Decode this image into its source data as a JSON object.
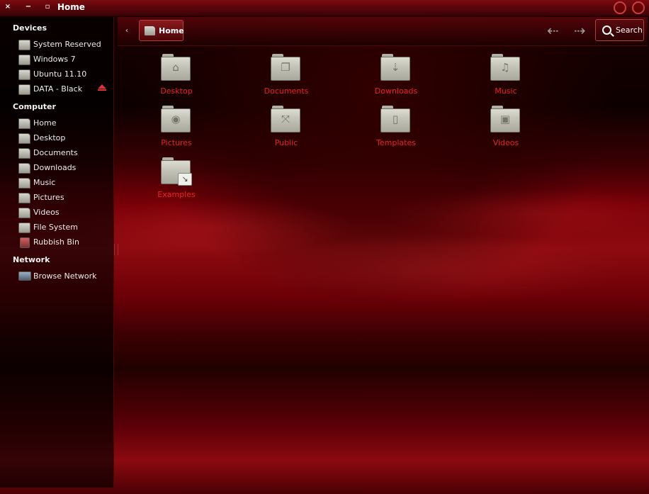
{
  "window": {
    "title": "Home"
  },
  "titlebar": {
    "close": "×",
    "minimize": "−",
    "maximize": "▫"
  },
  "sidebar": {
    "sections": [
      {
        "header": "Devices",
        "items": [
          {
            "label": "System Reserved",
            "icon": "drive-icon"
          },
          {
            "label": "Windows 7",
            "icon": "drive-icon"
          },
          {
            "label": "Ubuntu 11.10",
            "icon": "drive-icon"
          },
          {
            "label": "DATA - Black",
            "icon": "drive-icon",
            "eject": true
          }
        ]
      },
      {
        "header": "Computer",
        "items": [
          {
            "label": "Home",
            "icon": "home-folder-icon"
          },
          {
            "label": "Desktop",
            "icon": "desktop-folder-icon"
          },
          {
            "label": "Documents",
            "icon": "documents-folder-icon"
          },
          {
            "label": "Downloads",
            "icon": "downloads-folder-icon"
          },
          {
            "label": "Music",
            "icon": "music-folder-icon"
          },
          {
            "label": "Pictures",
            "icon": "pictures-folder-icon"
          },
          {
            "label": "Videos",
            "icon": "videos-folder-icon"
          },
          {
            "label": "File System",
            "icon": "file-system-icon"
          },
          {
            "label": "Rubbish Bin",
            "icon": "rubbish-bin-icon"
          }
        ]
      },
      {
        "header": "Network",
        "items": [
          {
            "label": "Browse Network",
            "icon": "network-icon"
          }
        ]
      }
    ]
  },
  "toolbar": {
    "breadcrumb_back": "‹",
    "breadcrumb_home": "Home",
    "nav_back": "⇠",
    "nav_forward": "⇢",
    "search_label": "Search"
  },
  "files": [
    {
      "name": "Desktop",
      "icon": "desktop-folder-icon",
      "glyph": "⌂"
    },
    {
      "name": "Documents",
      "icon": "documents-folder-icon",
      "glyph": "❐"
    },
    {
      "name": "Downloads",
      "icon": "downloads-folder-icon",
      "glyph": "⇣"
    },
    {
      "name": "Music",
      "icon": "music-folder-icon",
      "glyph": "♫"
    },
    {
      "name": "Pictures",
      "icon": "pictures-folder-icon",
      "glyph": "◉"
    },
    {
      "name": "Public",
      "icon": "public-folder-icon",
      "glyph": "⤧"
    },
    {
      "name": "Templates",
      "icon": "templates-folder-icon",
      "glyph": "▯"
    },
    {
      "name": "Videos",
      "icon": "videos-folder-icon",
      "glyph": "▣"
    },
    {
      "name": "Examples",
      "icon": "examples-folder-icon",
      "glyph": "",
      "badge": "↘"
    }
  ],
  "colors": {
    "accent": "#e8232a",
    "titlebar": "#7a0a0f"
  }
}
